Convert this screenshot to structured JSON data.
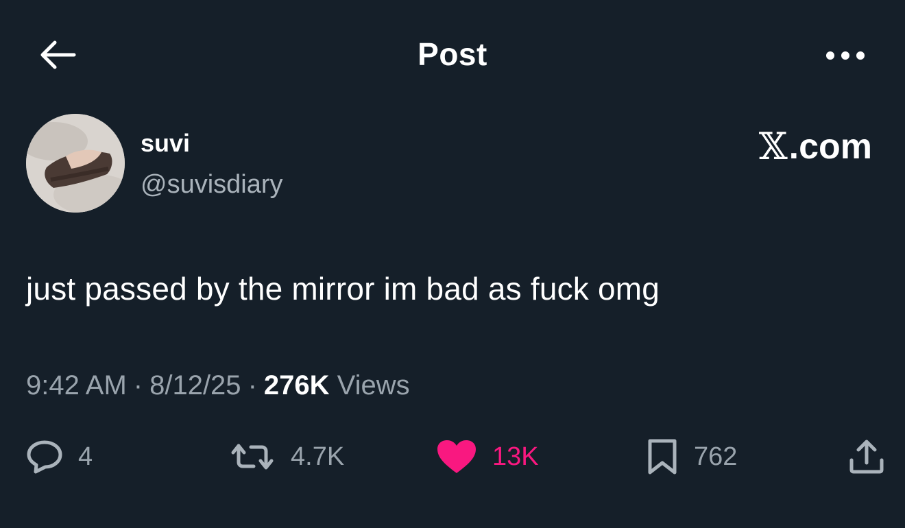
{
  "header": {
    "title": "Post",
    "back_icon": "arrow-left-icon",
    "more_icon": "more-horizontal-icon"
  },
  "author": {
    "name": "suvi",
    "handle": "@suvisdiary"
  },
  "watermark": {
    "x_glyph": "𝕏",
    "text": ".com"
  },
  "post": {
    "text": "just passed by the mirror im bad as fuck omg",
    "time": "9:42 AM",
    "date": "8/12/25",
    "views_count": "276K",
    "views_label": "Views",
    "separator": "·"
  },
  "actions": {
    "reply_count": "4",
    "repost_count": "4.7K",
    "like_count": "13K",
    "bookmark_count": "762"
  },
  "colors": {
    "background": "#151f29",
    "text": "#ffffff",
    "muted": "#9aa4ad",
    "like": "#f91880"
  }
}
